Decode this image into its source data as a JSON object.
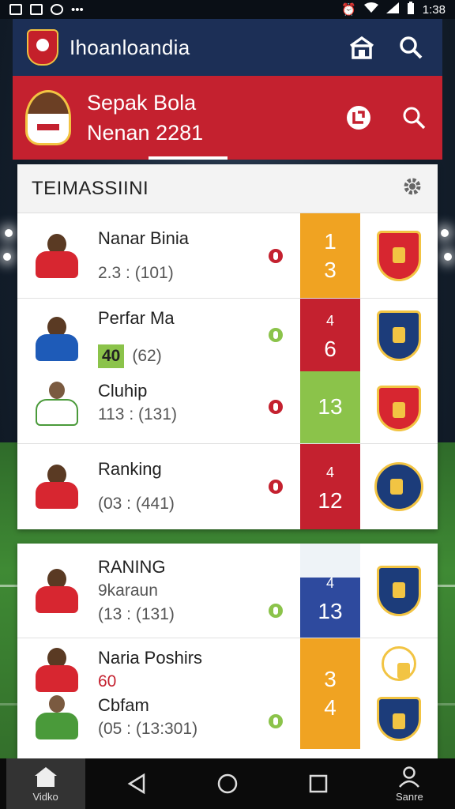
{
  "status_bar": {
    "time": "1:38"
  },
  "app_bar": {
    "title": "Ihoanloandia",
    "home_icon": "house-icon",
    "search_icon": "search-icon"
  },
  "hero": {
    "line1": "Sepak Bola",
    "line2": "Nenan 2281",
    "pin_icon": "pin-badge-icon",
    "search_icon": "search-icon"
  },
  "standings": {
    "title": "TEIMASSIINI",
    "settings_icon": "gear-icon",
    "rows": [
      {
        "name": "Nanar Binia",
        "stat": "2.3 : (101)",
        "badge": "",
        "rank_top": "1",
        "rank_bottom": "3",
        "rank_color": "#f0a322",
        "shirt_color": "#d72630",
        "crest_color": "#d72630"
      },
      {
        "name": "Perfar Ma",
        "stat": "(62)",
        "badge": "40",
        "rank_top": "4",
        "rank_bottom": "6",
        "rank_color": "#c4212f",
        "shirt_color": "#1e5bb8",
        "crest_color": "#1c3c7a"
      },
      {
        "name": "Cluhip",
        "stat": "113 : (131)",
        "badge": "",
        "rank_top": "",
        "rank_bottom": "13",
        "rank_color": "#8bc34a",
        "shirt_color": "#ffffff",
        "crest_color": "#d72630"
      },
      {
        "name": "Ranking",
        "stat": "(03 : (441)",
        "badge": "",
        "rank_top": "4",
        "rank_bottom": "12",
        "rank_color": "#c4212f",
        "shirt_color": "#d72630",
        "crest_color": "#1c3c7a"
      }
    ]
  },
  "standings2": {
    "rows": [
      {
        "name": "RANING",
        "sub": "9karaun",
        "stat": "(13 : (131)",
        "rank_top": "4",
        "rank_bottom": "13",
        "rank_color": "#2e4a9e",
        "shirt_color": "#d72630",
        "crest_color": "#1c3c7a"
      },
      {
        "name": "Naria Poshirs",
        "sub": "60",
        "sub2": "Cbfam",
        "stat": "(05 : (13:301)",
        "rank_top": "3",
        "rank_bottom": "4",
        "rank_color": "#f0a322",
        "shirt_color": "#d72630",
        "crest_color": "#1c3c7a"
      }
    ]
  },
  "nav": {
    "home_label": "Vidko",
    "profile_label": "Sanre"
  }
}
